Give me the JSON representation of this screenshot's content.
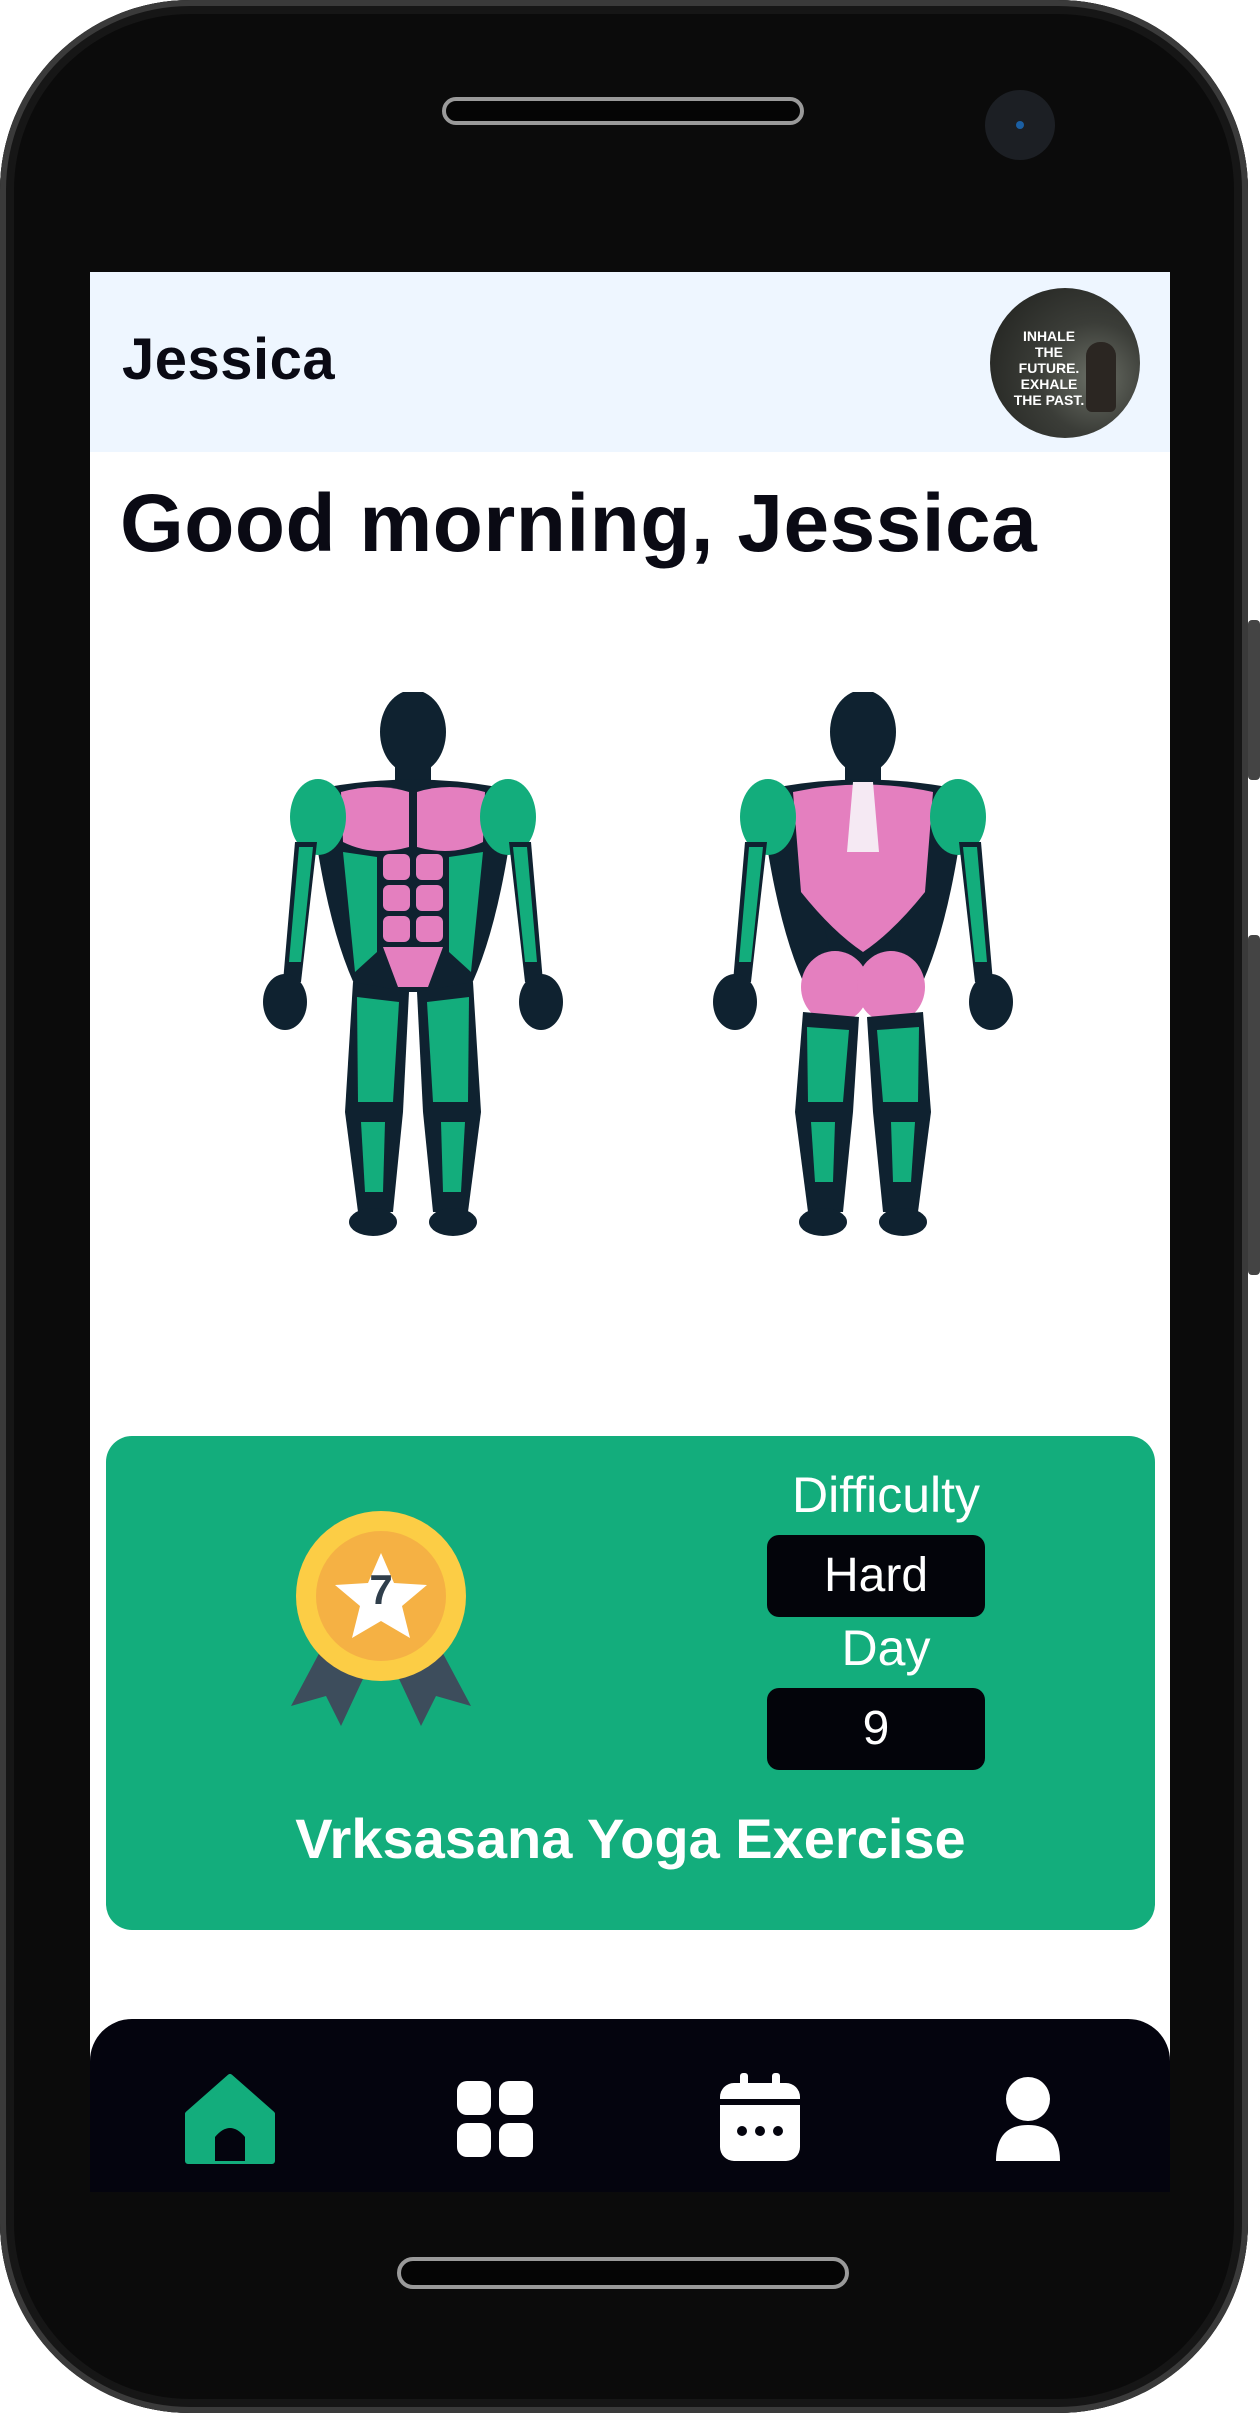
{
  "header": {
    "user_name": "Jessica",
    "avatar_quote": [
      "INHALE",
      "THE FUTURE.",
      "EXHALE",
      "THE PAST."
    ]
  },
  "greeting": "Good morning, Jessica",
  "exercise_card": {
    "badge_number": "7",
    "difficulty_label": "Difficulty",
    "difficulty_value": "Hard",
    "day_label": "Day",
    "day_value": "9",
    "title": "Vrksasana Yoga Exercise"
  },
  "nav": {
    "items": [
      {
        "icon": "home-icon",
        "active": true
      },
      {
        "icon": "grid-icon",
        "active": false
      },
      {
        "icon": "calendar-icon",
        "active": false
      },
      {
        "icon": "profile-icon",
        "active": false
      }
    ]
  },
  "colors": {
    "accent": "#13ad7c",
    "header_bg": "#eef6ff",
    "nav_bg": "#04040e",
    "muscle_pink": "#e47fbf",
    "muscle_green": "#13ad7c",
    "body_dark": "#0f2230"
  }
}
